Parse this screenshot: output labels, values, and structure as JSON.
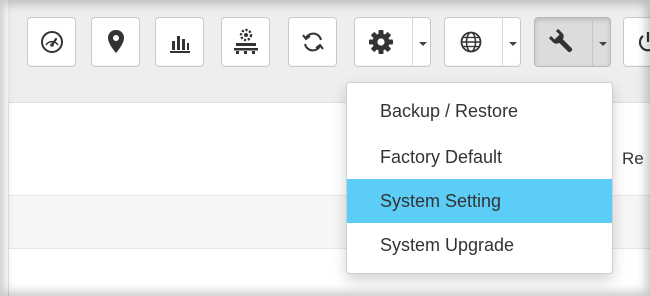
{
  "toolbar": {
    "buttons": [
      {
        "icon": "dashboard-icon"
      },
      {
        "icon": "location-pin-icon"
      },
      {
        "icon": "bar-chart-icon"
      },
      {
        "icon": "device-network-icon"
      },
      {
        "icon": "refresh-icon"
      },
      {
        "icon": "gear-icon",
        "dropdown": true
      },
      {
        "icon": "globe-icon",
        "dropdown": true
      },
      {
        "icon": "wrench-icon",
        "dropdown": true,
        "active": true
      },
      {
        "icon": "power-icon"
      }
    ]
  },
  "content": {
    "cut_label": "Re"
  },
  "menu": {
    "items": [
      {
        "label": "Backup / Restore",
        "highlighted": false
      },
      {
        "label": "Factory Default",
        "highlighted": false
      },
      {
        "label": "System Setting",
        "highlighted": true
      },
      {
        "label": "System Upgrade",
        "highlighted": false
      }
    ],
    "highlight_color": "#5bcdf7"
  },
  "colors": {
    "toolbar_bg": "#eeeeee",
    "icon": "#333333"
  }
}
